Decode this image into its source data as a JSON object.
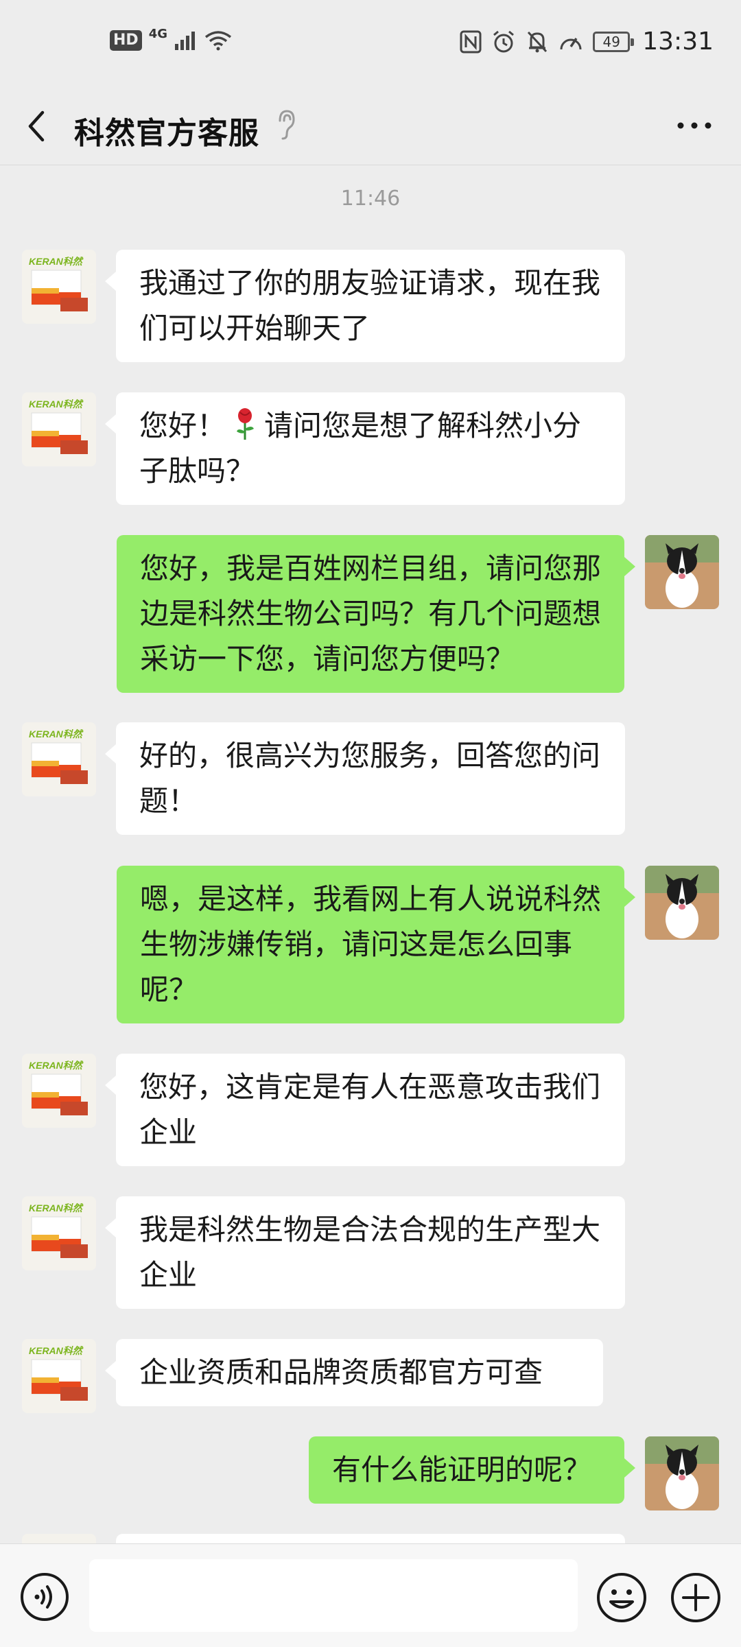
{
  "status_bar": {
    "hd": "HD",
    "network": "4G",
    "battery": "49",
    "time": "13:31"
  },
  "nav": {
    "title": "科然官方客服"
  },
  "chat": {
    "timestamp": "11:46",
    "messages": [
      {
        "side": "in",
        "text": "我通过了你的朋友验证请求，现在我们可以开始聊天了"
      },
      {
        "side": "in",
        "text_before": "您好！",
        "text_after": "请问您是想了解科然小分子肽吗？"
      },
      {
        "side": "out",
        "text": "您好，我是百姓网栏目组，请问您那边是科然生物公司吗？有几个问题想采访一下您，请问您方便吗？"
      },
      {
        "side": "in",
        "text": "好的，很高兴为您服务，回答您的问题！"
      },
      {
        "side": "out",
        "text": "嗯，是这样，我看网上有人说说科然生物涉嫌传销，请问这是怎么回事呢？"
      },
      {
        "side": "in",
        "text": "您好，这肯定是有人在恶意攻击我们企业"
      },
      {
        "side": "in",
        "text": "我是科然生物是合法合规的生产型大企业"
      },
      {
        "side": "in",
        "text": "企业资质和品牌资质都官方可查"
      },
      {
        "side": "out",
        "text": "有什么能证明的呢？"
      }
    ]
  },
  "avatar_brand_text": "KERAN科然",
  "colors": {
    "outgoing_bubble": "#95ec69",
    "incoming_bubble": "#ffffff",
    "chat_background": "#ededed"
  },
  "icons": {
    "back": "chevron-left-icon",
    "ear": "ear-icon",
    "more": "more-dots-icon",
    "voice": "voice-icon",
    "emoji": "emoji-icon",
    "plus": "plus-icon"
  }
}
